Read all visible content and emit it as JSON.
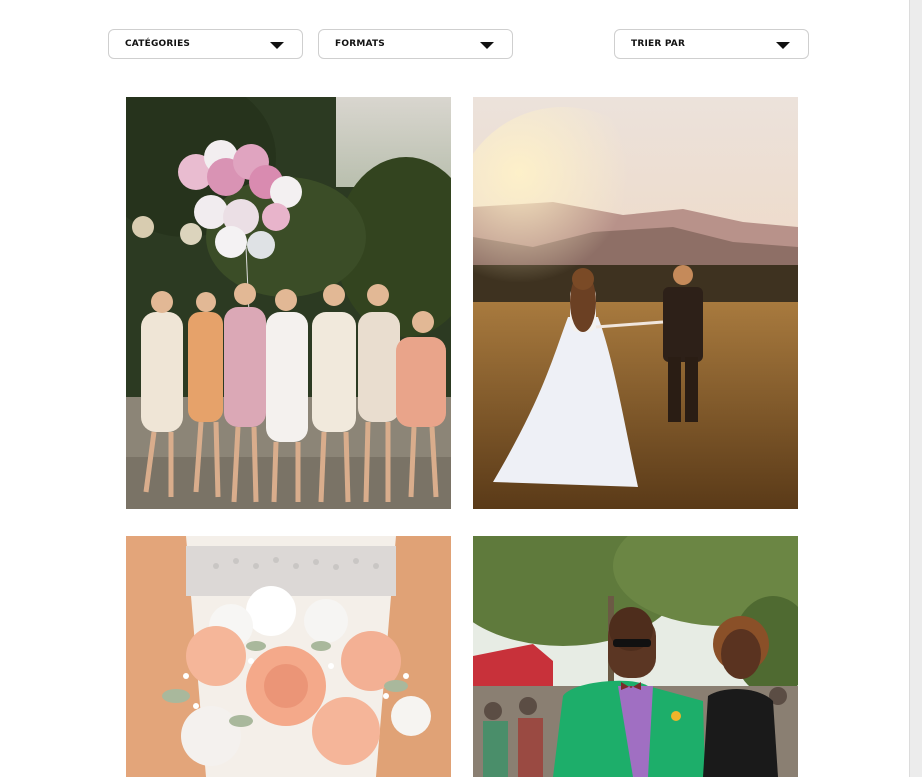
{
  "filters": {
    "categories_label": "CATÉGORIES",
    "formats_label": "FORMATS",
    "sort_label": "TRIER PAR"
  },
  "gallery": {
    "photos": [
      {
        "subject": "bridesmaids-with-balloons"
      },
      {
        "subject": "wedding-couple-sunset-field"
      },
      {
        "subject": "bridal-bouquet-roses"
      },
      {
        "subject": "guests-at-outdoor-party"
      }
    ]
  }
}
